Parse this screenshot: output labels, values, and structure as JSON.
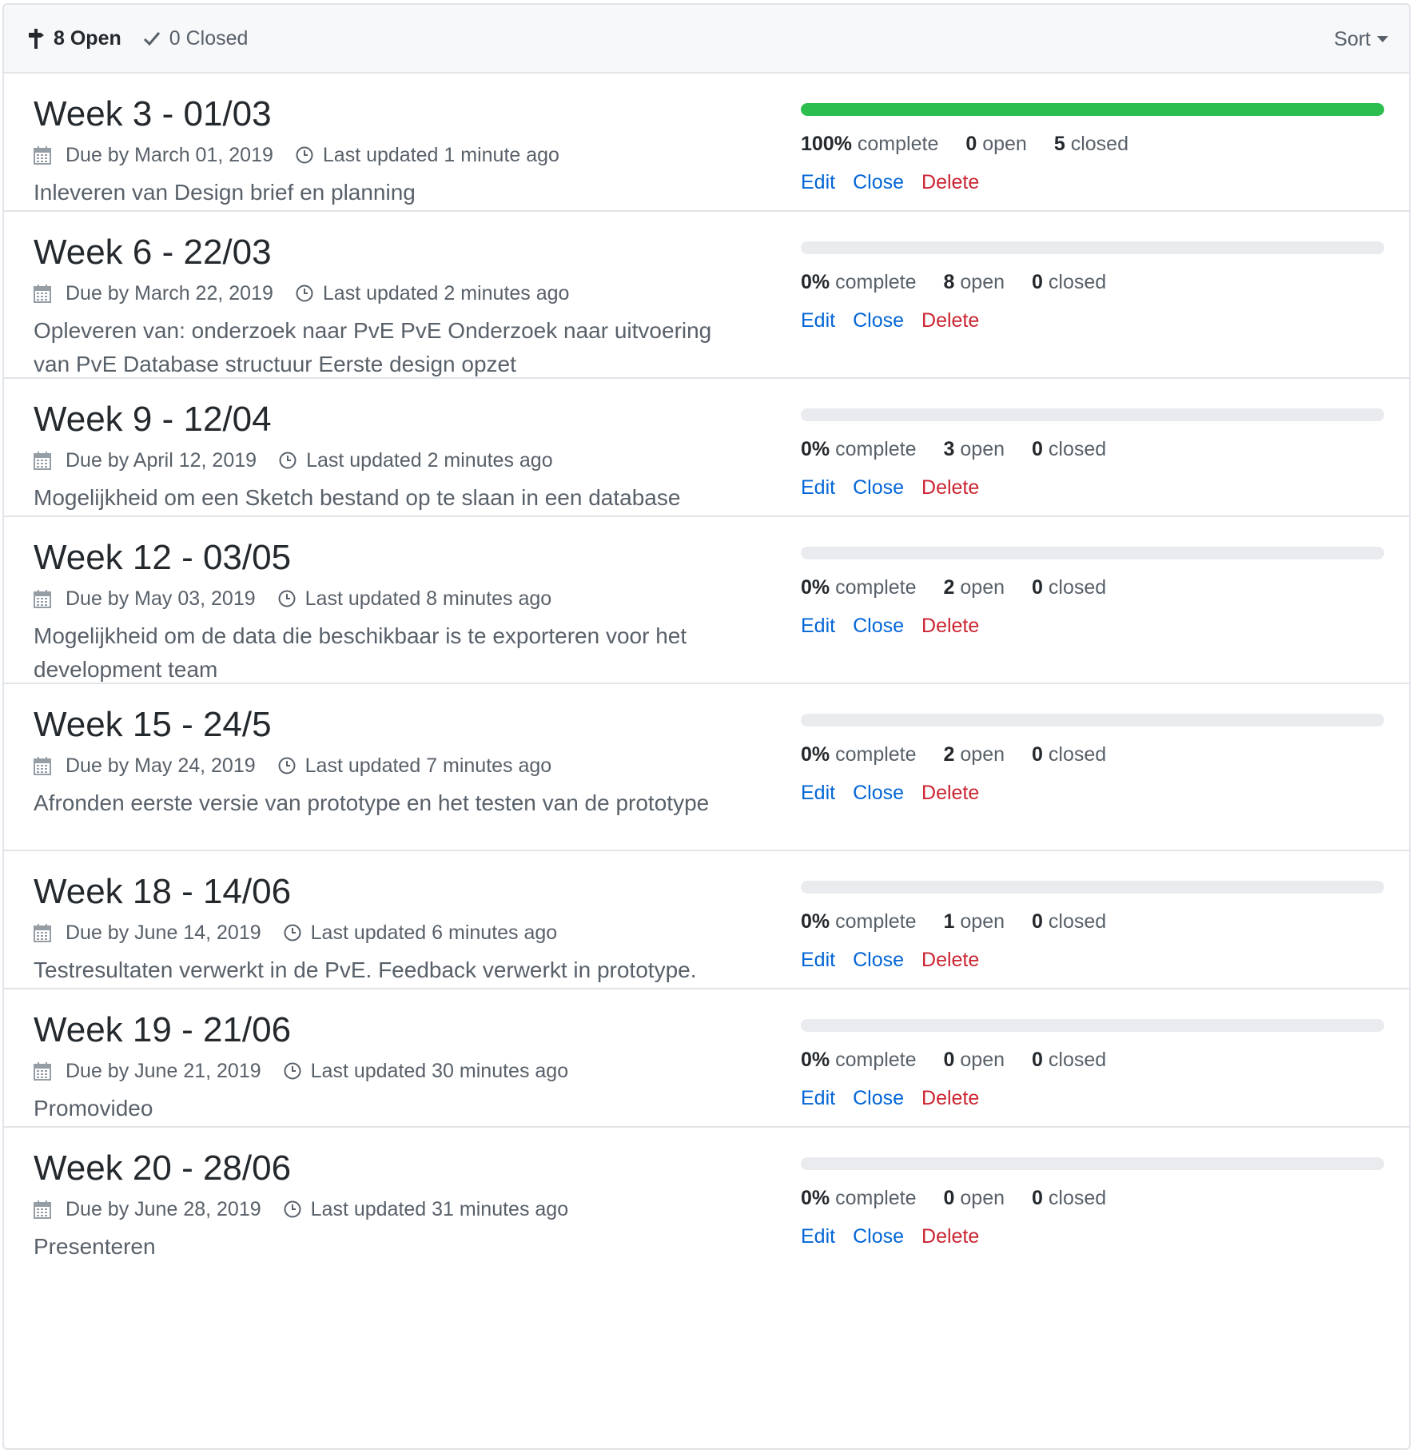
{
  "header": {
    "open_label": "8 Open",
    "closed_label": "0 Closed",
    "sort_label": "Sort"
  },
  "milestones": [
    {
      "title": "Week 3 - 01/03",
      "due": "Due by March 01, 2019",
      "updated": "Last updated 1 minute ago",
      "description": "Inleveren van Design brief en planning",
      "progress": 1.0,
      "percent": "100%",
      "complete_label": "complete",
      "open_count": "0",
      "open_label": "open",
      "closed_count": "5",
      "closed_label": "closed",
      "edit": "Edit",
      "close": "Close",
      "delete": "Delete"
    },
    {
      "title": "Week 6 - 22/03",
      "due": "Due by March 22, 2019",
      "updated": "Last updated 2 minutes ago",
      "description": "Opleveren van: onderzoek naar PvE PvE Onderzoek naar uitvoering van PvE Database structuur Eerste design opzet",
      "progress": 0,
      "percent": "0%",
      "complete_label": "complete",
      "open_count": "8",
      "open_label": "open",
      "closed_count": "0",
      "closed_label": "closed",
      "edit": "Edit",
      "close": "Close",
      "delete": "Delete"
    },
    {
      "title": "Week 9 - 12/04",
      "due": "Due by April 12, 2019",
      "updated": "Last updated 2 minutes ago",
      "description": "Mogelijkheid om een Sketch bestand op te slaan in een database",
      "progress": 0,
      "percent": "0%",
      "complete_label": "complete",
      "open_count": "3",
      "open_label": "open",
      "closed_count": "0",
      "closed_label": "closed",
      "edit": "Edit",
      "close": "Close",
      "delete": "Delete"
    },
    {
      "title": "Week 12 - 03/05",
      "due": "Due by May 03, 2019",
      "updated": "Last updated 8 minutes ago",
      "description": "Mogelijkheid om de data die beschikbaar is te exporteren voor het development team",
      "progress": 0,
      "percent": "0%",
      "complete_label": "complete",
      "open_count": "2",
      "open_label": "open",
      "closed_count": "0",
      "closed_label": "closed",
      "edit": "Edit",
      "close": "Close",
      "delete": "Delete"
    },
    {
      "title": "Week 15 - 24/5",
      "due": "Due by May 24, 2019",
      "updated": "Last updated 7 minutes ago",
      "description": "Afronden eerste versie van prototype en het testen van de prototype",
      "progress": 0,
      "percent": "0%",
      "complete_label": "complete",
      "open_count": "2",
      "open_label": "open",
      "closed_count": "0",
      "closed_label": "closed",
      "edit": "Edit",
      "close": "Close",
      "delete": "Delete"
    },
    {
      "title": "Week 18 - 14/06",
      "due": "Due by June 14, 2019",
      "updated": "Last updated 6 minutes ago",
      "description": "Testresultaten verwerkt in de PvE. Feedback verwerkt in prototype.",
      "progress": 0,
      "percent": "0%",
      "complete_label": "complete",
      "open_count": "1",
      "open_label": "open",
      "closed_count": "0",
      "closed_label": "closed",
      "edit": "Edit",
      "close": "Close",
      "delete": "Delete"
    },
    {
      "title": "Week 19 - 21/06",
      "due": "Due by June 21, 2019",
      "updated": "Last updated 30 minutes ago",
      "description": "Promovideo",
      "progress": 0,
      "percent": "0%",
      "complete_label": "complete",
      "open_count": "0",
      "open_label": "open",
      "closed_count": "0",
      "closed_label": "closed",
      "edit": "Edit",
      "close": "Close",
      "delete": "Delete"
    },
    {
      "title": "Week 20 - 28/06",
      "due": "Due by June 28, 2019",
      "updated": "Last updated 31 minutes ago",
      "description": "Presenteren",
      "progress": 0,
      "percent": "0%",
      "complete_label": "complete",
      "open_count": "0",
      "open_label": "open",
      "closed_count": "0",
      "closed_label": "closed",
      "edit": "Edit",
      "close": "Close",
      "delete": "Delete"
    }
  ],
  "icons": {
    "open_state": "milestone-icon",
    "closed_state": "check-icon",
    "due": "calendar-icon",
    "updated": "clock-icon"
  },
  "colors": {
    "progress_fill": "#2cbe4e",
    "progress_track": "#e9ebee",
    "link": "#0366d6",
    "danger": "#cb2431"
  }
}
